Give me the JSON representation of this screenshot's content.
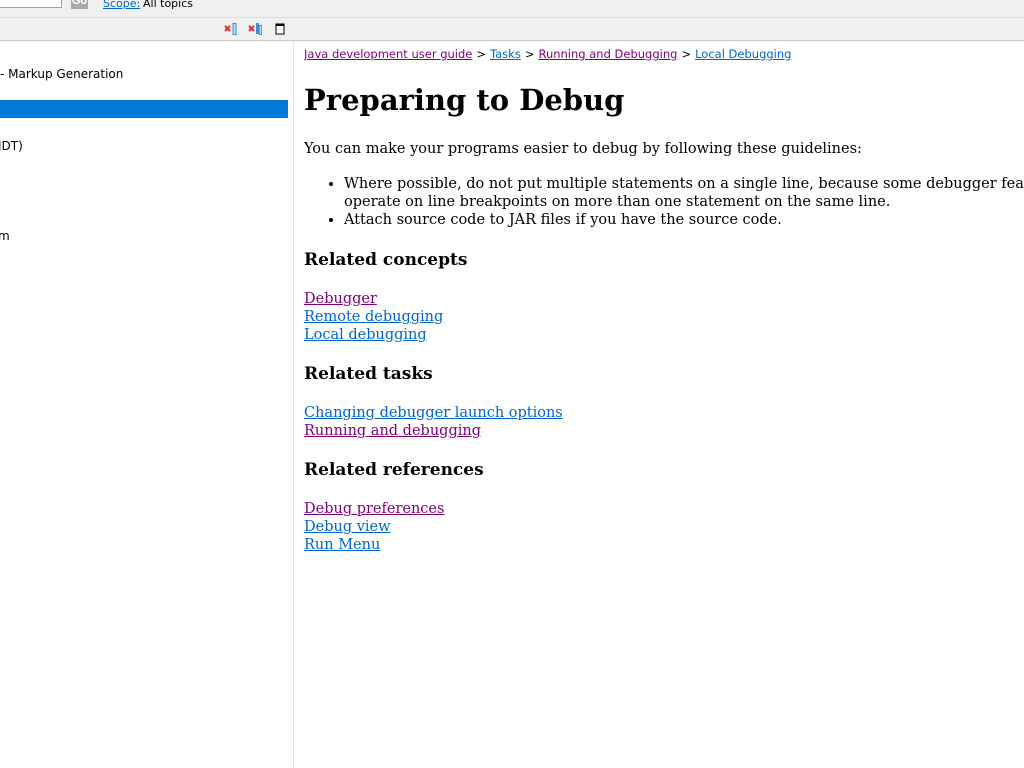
{
  "search": {
    "value": "",
    "go_label": "Go",
    "scope_label": "Scope:",
    "scope_value": "All topics"
  },
  "toolbar": {
    "icons": [
      "remove-bookmark-icon",
      "remove-all-bookmarks-icon",
      "maximize-icon"
    ]
  },
  "tree": {
    "items": [
      {
        "label": " - Markup Generation",
        "selected": false
      },
      {
        "label": "",
        "selected": true
      },
      {
        "label": "JDT)",
        "selected": false
      },
      {
        "label": "m",
        "selected": false
      }
    ]
  },
  "breadcrumb": {
    "items": [
      {
        "label": "Java development user guide",
        "visited": true
      },
      {
        "label": "Tasks",
        "visited": false
      },
      {
        "label": "Running and Debugging",
        "visited": true
      },
      {
        "label": "Local Debugging",
        "visited": false
      }
    ],
    "separator": ">"
  },
  "page": {
    "title": "Preparing to Debug",
    "intro": "You can make your programs easier to debug by following these guidelines:",
    "guidelines": [
      "Where possible, do not put multiple statements on a single line, because some debugger features operate on line breakpoints on more than one statement on the same line.",
      "Attach source code to JAR files if you have the source code."
    ]
  },
  "related_concepts": {
    "heading": "Related concepts",
    "links": [
      {
        "label": "Debugger",
        "visited": true
      },
      {
        "label": "Remote debugging",
        "visited": false
      },
      {
        "label": "Local debugging",
        "visited": false
      }
    ]
  },
  "related_tasks": {
    "heading": "Related tasks",
    "links": [
      {
        "label": "Changing debugger launch options",
        "visited": false
      },
      {
        "label": "Running and debugging",
        "visited": true
      }
    ]
  },
  "related_references": {
    "heading": "Related references",
    "links": [
      {
        "label": "Debug preferences",
        "visited": true
      },
      {
        "label": "Debug view",
        "visited": false
      },
      {
        "label": "Run Menu",
        "visited": false
      }
    ]
  },
  "colors": {
    "link": "#0066cc",
    "visited_link": "#800080",
    "selection": "#0078d7"
  }
}
